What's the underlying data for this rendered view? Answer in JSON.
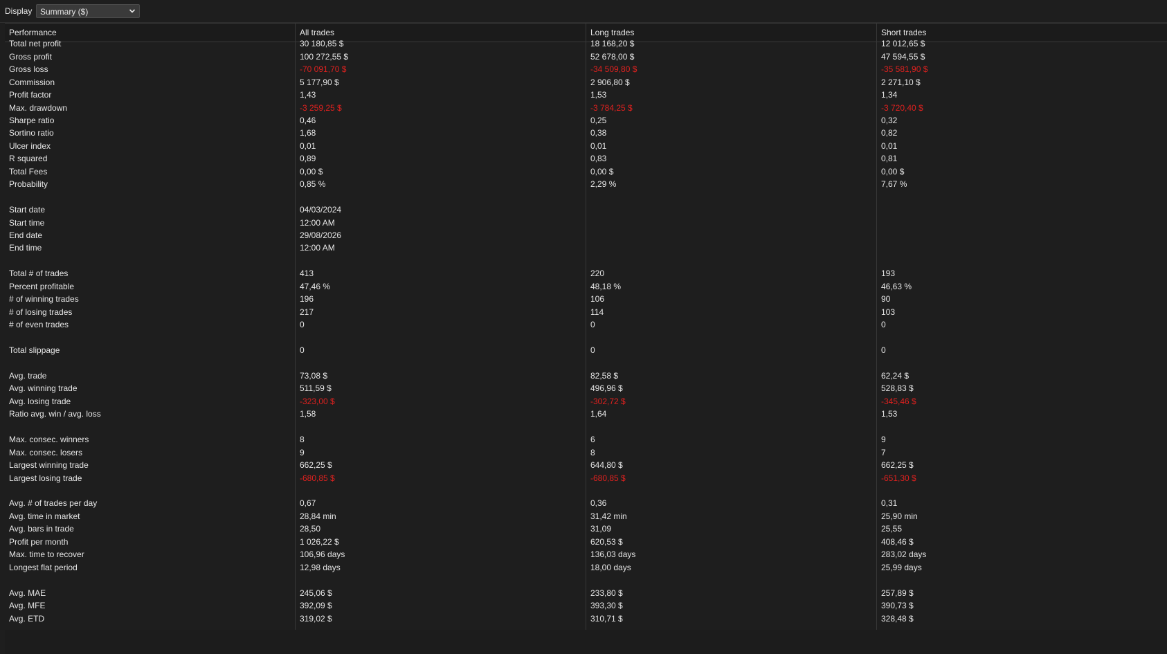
{
  "toolbar": {
    "display_label": "Display",
    "display_value": "Summary ($)"
  },
  "table": {
    "columns": [
      "Performance",
      "All trades",
      "Long trades",
      "Short trades"
    ],
    "rows": [
      {
        "label": "Total net profit",
        "all": "30 180,85 $",
        "long": "18 168,20 $",
        "short": "12 012,65 $",
        "negative": false
      },
      {
        "label": "Gross profit",
        "all": "100 272,55 $",
        "long": "52 678,00 $",
        "short": "47 594,55 $",
        "negative": false
      },
      {
        "label": "Gross loss",
        "all": "-70 091,70 $",
        "long": "-34 509,80 $",
        "short": "-35 581,90 $",
        "negative": true
      },
      {
        "label": "Commission",
        "all": "5 177,90 $",
        "long": "2 906,80 $",
        "short": "2 271,10 $",
        "negative": false
      },
      {
        "label": "Profit factor",
        "all": "1,43",
        "long": "1,53",
        "short": "1,34",
        "negative": false
      },
      {
        "label": "Max. drawdown",
        "all": "-3 259,25 $",
        "long": "-3 784,25 $",
        "short": "-3 720,40 $",
        "negative": true
      },
      {
        "label": "Sharpe ratio",
        "all": "0,46",
        "long": "0,25",
        "short": "0,32",
        "negative": false
      },
      {
        "label": "Sortino ratio",
        "all": "1,68",
        "long": "0,38",
        "short": "0,82",
        "negative": false
      },
      {
        "label": "Ulcer index",
        "all": "0,01",
        "long": "0,01",
        "short": "0,01",
        "negative": false
      },
      {
        "label": "R squared",
        "all": "0,89",
        "long": "0,83",
        "short": "0,81",
        "negative": false
      },
      {
        "label": "Total Fees",
        "all": "0,00 $",
        "long": "0,00 $",
        "short": "0,00 $",
        "negative": false
      },
      {
        "label": "Probability",
        "all": "0,85 %",
        "long": "2,29 %",
        "short": "7,67 %",
        "negative": false
      },
      {
        "label": "",
        "all": "",
        "long": "",
        "short": "",
        "negative": false
      },
      {
        "label": "Start date",
        "all": "04/03/2024",
        "long": "",
        "short": "",
        "negative": false
      },
      {
        "label": "Start time",
        "all": "12:00 AM",
        "long": "",
        "short": "",
        "negative": false
      },
      {
        "label": "End date",
        "all": "29/08/2026",
        "long": "",
        "short": "",
        "negative": false
      },
      {
        "label": "End time",
        "all": "12:00 AM",
        "long": "",
        "short": "",
        "negative": false
      },
      {
        "label": "",
        "all": "",
        "long": "",
        "short": "",
        "negative": false
      },
      {
        "label": "Total # of trades",
        "all": "413",
        "long": "220",
        "short": "193",
        "negative": false
      },
      {
        "label": "Percent profitable",
        "all": "47,46 %",
        "long": "48,18 %",
        "short": "46,63 %",
        "negative": false
      },
      {
        "label": "# of winning trades",
        "all": "196",
        "long": "106",
        "short": "90",
        "negative": false
      },
      {
        "label": "# of losing trades",
        "all": "217",
        "long": "114",
        "short": "103",
        "negative": false
      },
      {
        "label": "# of even trades",
        "all": "0",
        "long": "0",
        "short": "0",
        "negative": false
      },
      {
        "label": "",
        "all": "",
        "long": "",
        "short": "",
        "negative": false
      },
      {
        "label": "Total slippage",
        "all": "0",
        "long": "0",
        "short": "0",
        "negative": false
      },
      {
        "label": "",
        "all": "",
        "long": "",
        "short": "",
        "negative": false
      },
      {
        "label": "Avg. trade",
        "all": "73,08 $",
        "long": "82,58 $",
        "short": "62,24 $",
        "negative": false
      },
      {
        "label": "Avg. winning trade",
        "all": "511,59 $",
        "long": "496,96 $",
        "short": "528,83 $",
        "negative": false
      },
      {
        "label": "Avg. losing trade",
        "all": "-323,00 $",
        "long": "-302,72 $",
        "short": "-345,46 $",
        "negative": true
      },
      {
        "label": "Ratio avg. win / avg. loss",
        "all": "1,58",
        "long": "1,64",
        "short": "1,53",
        "negative": false
      },
      {
        "label": "",
        "all": "",
        "long": "",
        "short": "",
        "negative": false
      },
      {
        "label": "Max. consec. winners",
        "all": "8",
        "long": "6",
        "short": "9",
        "negative": false
      },
      {
        "label": "Max. consec. losers",
        "all": "9",
        "long": "8",
        "short": "7",
        "negative": false
      },
      {
        "label": "Largest winning trade",
        "all": "662,25 $",
        "long": "644,80 $",
        "short": "662,25 $",
        "negative": false
      },
      {
        "label": "Largest losing trade",
        "all": "-680,85 $",
        "long": "-680,85 $",
        "short": "-651,30 $",
        "negative": true
      },
      {
        "label": "",
        "all": "",
        "long": "",
        "short": "",
        "negative": false
      },
      {
        "label": "Avg. # of trades per day",
        "all": "0,67",
        "long": "0,36",
        "short": "0,31",
        "negative": false
      },
      {
        "label": "Avg. time in market",
        "all": "28,84 min",
        "long": "31,42 min",
        "short": "25,90 min",
        "negative": false
      },
      {
        "label": "Avg. bars in trade",
        "all": "28,50",
        "long": "31,09",
        "short": "25,55",
        "negative": false
      },
      {
        "label": "Profit per month",
        "all": "1 026,22 $",
        "long": "620,53 $",
        "short": "408,46 $",
        "negative": false
      },
      {
        "label": "Max. time to recover",
        "all": "106,96 days",
        "long": "136,03 days",
        "short": "283,02 days",
        "negative": false
      },
      {
        "label": "Longest flat period",
        "all": "12,98 days",
        "long": "18,00 days",
        "short": "25,99 days",
        "negative": false
      },
      {
        "label": "",
        "all": "",
        "long": "",
        "short": "",
        "negative": false
      },
      {
        "label": "Avg. MAE",
        "all": "245,06 $",
        "long": "233,80 $",
        "short": "257,89 $",
        "negative": false
      },
      {
        "label": "Avg. MFE",
        "all": "392,09 $",
        "long": "393,30 $",
        "short": "390,73 $",
        "negative": false
      },
      {
        "label": "Avg. ETD",
        "all": "319,02 $",
        "long": "310,71 $",
        "short": "328,48 $",
        "negative": false
      }
    ]
  },
  "colors": {
    "background": "#1e1e1e",
    "text": "#e6e6e6",
    "negative": "#e0211f",
    "grid_line": "#383838"
  }
}
